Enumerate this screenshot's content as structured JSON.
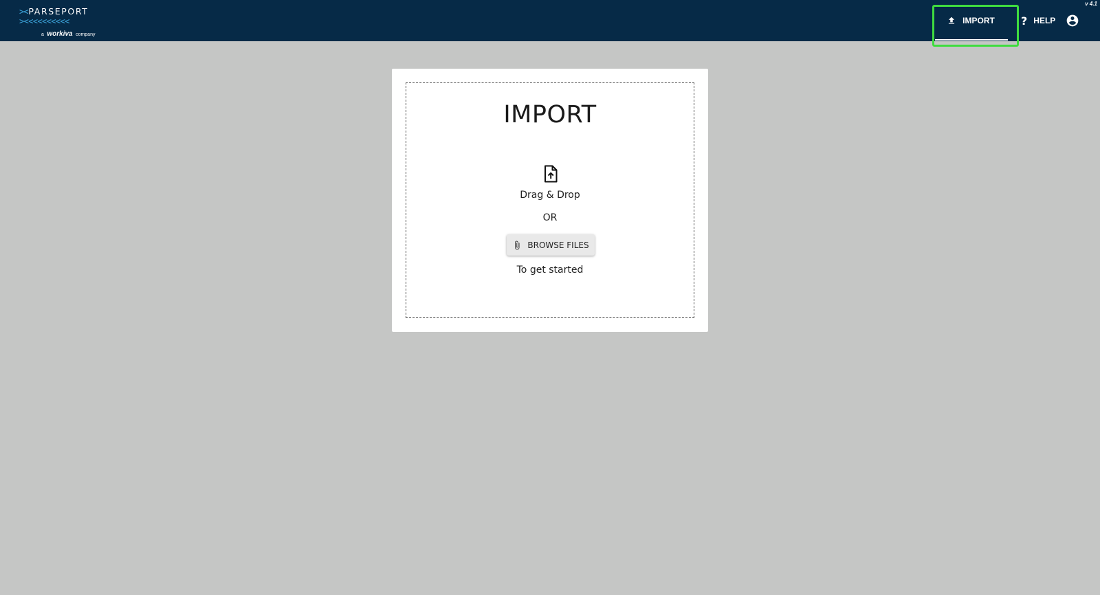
{
  "header": {
    "logo": {
      "arrows_top": "><",
      "wordmark": "PARSEPORT",
      "arrows_bottom": "><<<<<<<<<<",
      "tagline_prefix": "a",
      "tagline_brand": "workiva",
      "tagline_suffix": "company"
    },
    "version": "v 4.1",
    "nav": {
      "import_label": "IMPORT",
      "help_label": "HELP"
    },
    "icons": {
      "import": "upload-icon",
      "help": "question-icon",
      "account": "account-circle-icon"
    },
    "colors": {
      "background": "#062a47",
      "accent": "#3fa9e0",
      "highlight": "#3fdc3f"
    }
  },
  "import_card": {
    "title": "IMPORT",
    "drag_drop": "Drag & Drop",
    "or": "OR",
    "browse_label": "BROWSE FILES",
    "hint": "To get started",
    "icons": {
      "file": "file-upload-icon",
      "browse": "paperclip-icon"
    }
  }
}
